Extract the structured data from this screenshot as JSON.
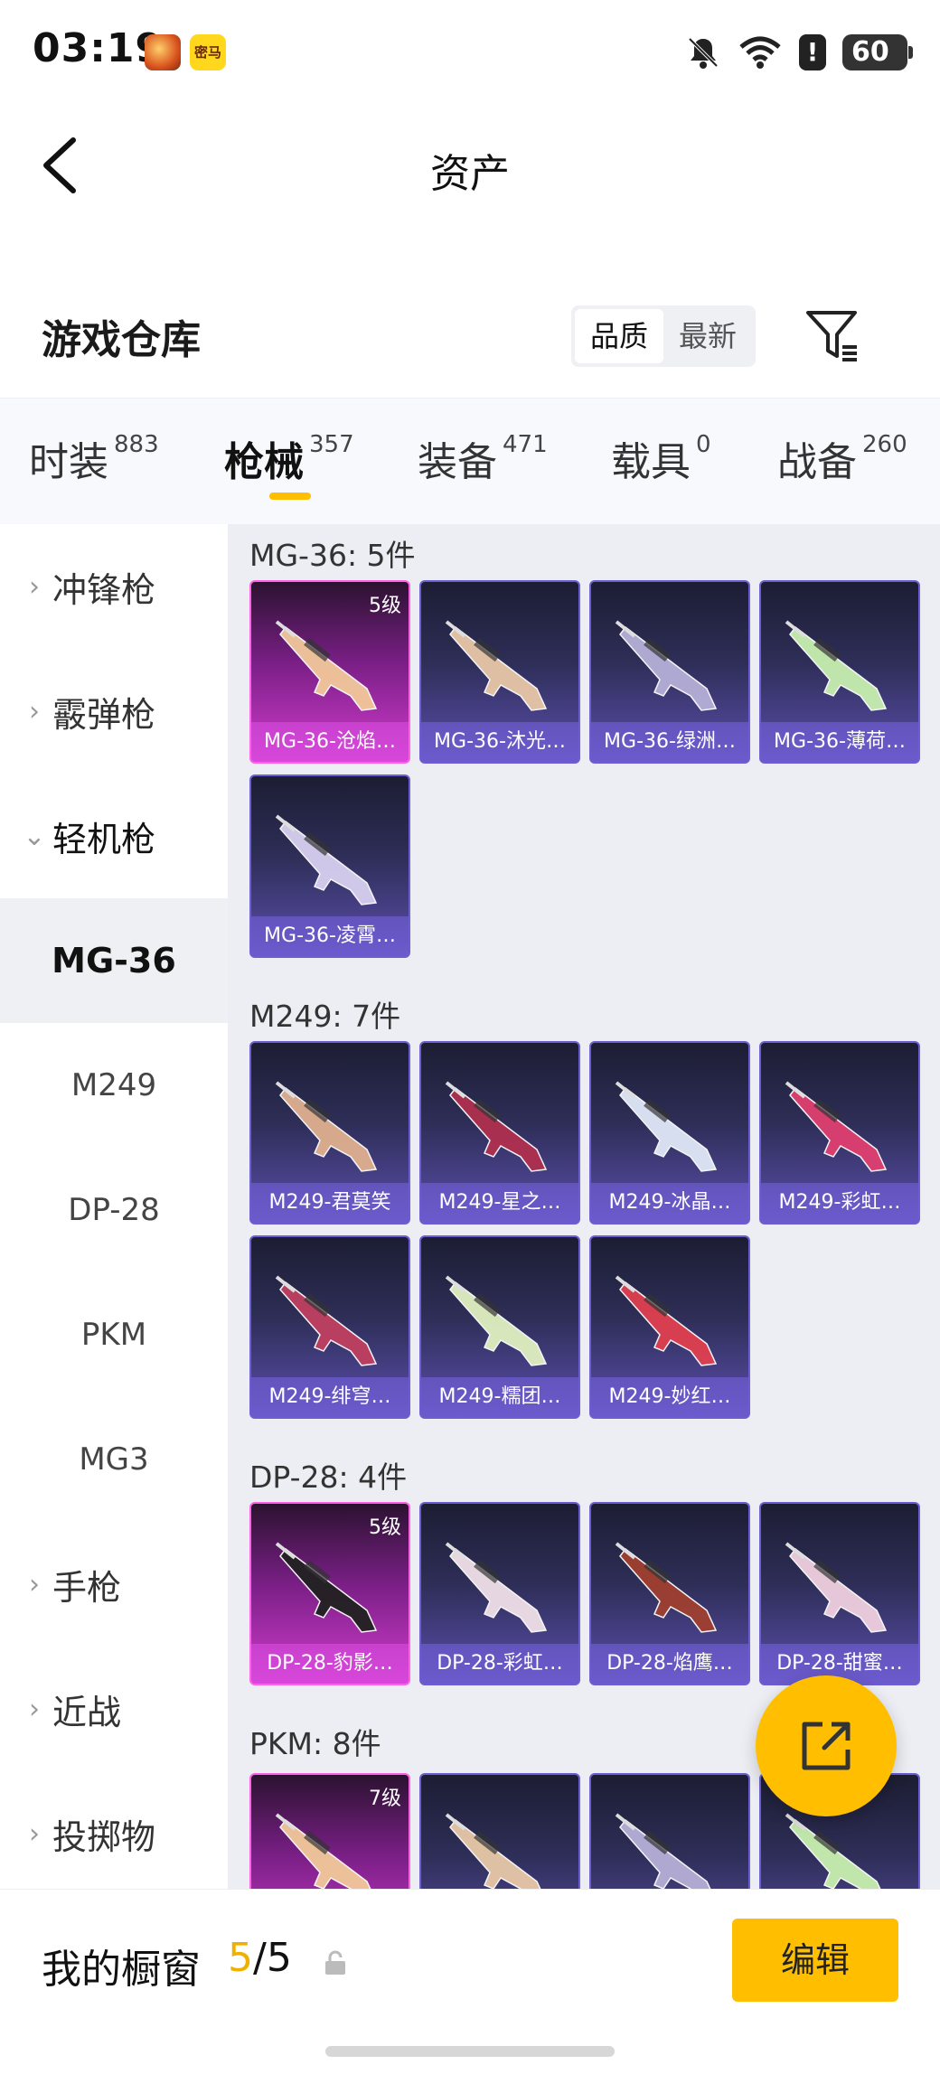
{
  "status_bar": {
    "time": "03:19",
    "battery": "60",
    "app2_label": "密马"
  },
  "header": {
    "title": "资产"
  },
  "warehouse": {
    "title": "游戏仓库",
    "sort_options": [
      "品质",
      "最新"
    ],
    "active_sort": "品质"
  },
  "categories": [
    {
      "label": "时装",
      "count": "883"
    },
    {
      "label": "枪械",
      "count": "357"
    },
    {
      "label": "装备",
      "count": "471"
    },
    {
      "label": "载具",
      "count": "0"
    },
    {
      "label": "战备",
      "count": "260"
    }
  ],
  "sidebar": {
    "groups": [
      {
        "label": "冲锋枪",
        "expanded": false
      },
      {
        "label": "霰弹枪",
        "expanded": false
      },
      {
        "label": "轻机枪",
        "expanded": true
      }
    ],
    "sub_items": [
      "MG-36",
      "M249",
      "DP-28",
      "PKM",
      "MG3"
    ],
    "active_sub": "MG-36",
    "more_groups": [
      "手枪",
      "近战",
      "投掷物"
    ]
  },
  "groups": [
    {
      "title": "MG-36: 5件",
      "items": [
        {
          "name": "MG-36-沧焰…",
          "level": "5级",
          "rarity": "gold"
        },
        {
          "name": "MG-36-沐光…",
          "level": "",
          "rarity": "purple"
        },
        {
          "name": "MG-36-绿洲…",
          "level": "",
          "rarity": "purple"
        },
        {
          "name": "MG-36-薄荷…",
          "level": "",
          "rarity": "purple"
        },
        {
          "name": "MG-36-凌霄…",
          "level": "",
          "rarity": "purple"
        }
      ]
    },
    {
      "title": "M249: 7件",
      "items": [
        {
          "name": "M249-君莫笑",
          "level": "",
          "rarity": "purple"
        },
        {
          "name": "M249-星之…",
          "level": "",
          "rarity": "purple"
        },
        {
          "name": "M249-冰晶…",
          "level": "",
          "rarity": "purple"
        },
        {
          "name": "M249-彩虹…",
          "level": "",
          "rarity": "purple"
        },
        {
          "name": "M249-绯穹…",
          "level": "",
          "rarity": "purple"
        },
        {
          "name": "M249-糯团…",
          "level": "",
          "rarity": "purple"
        },
        {
          "name": "M249-妙红…",
          "level": "",
          "rarity": "purple"
        }
      ]
    },
    {
      "title": "DP-28: 4件",
      "items": [
        {
          "name": "DP-28-豹影…",
          "level": "5级",
          "rarity": "gold"
        },
        {
          "name": "DP-28-彩虹…",
          "level": "",
          "rarity": "purple"
        },
        {
          "name": "DP-28-焰鹰…",
          "level": "",
          "rarity": "purple"
        },
        {
          "name": "DP-28-甜蜜…",
          "level": "",
          "rarity": "purple"
        }
      ]
    },
    {
      "title": "PKM: 8件",
      "items": [
        {
          "name": "",
          "level": "7级",
          "rarity": "gold"
        },
        {
          "name": "",
          "level": "",
          "rarity": "purple"
        },
        {
          "name": "",
          "level": "",
          "rarity": "purple"
        },
        {
          "name": "",
          "level": "",
          "rarity": "purple"
        }
      ]
    }
  ],
  "showcase": {
    "title": "我的橱窗",
    "current": "5",
    "total": "/5",
    "edit_label": "编辑"
  },
  "colors": {
    "accent": "#ffbf00",
    "gold_card": "#d23ccd",
    "purple_card": "#5c4fae"
  }
}
